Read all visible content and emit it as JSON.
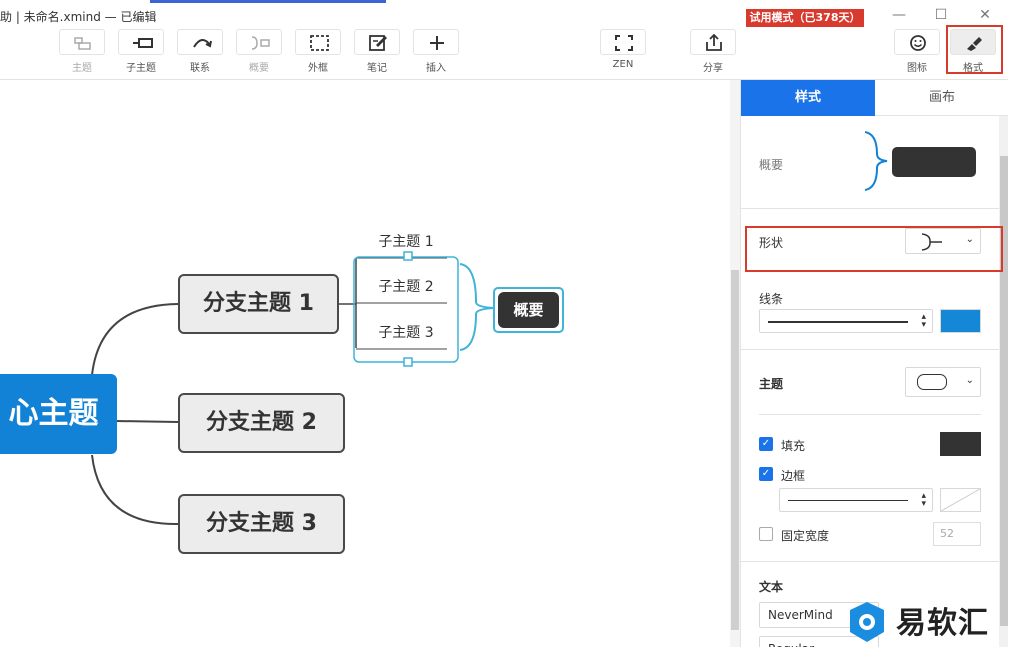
{
  "titlebar": {
    "title": "助  | 未命名.xmind  — 已编辑",
    "trial_badge": "试用模式（已378天）",
    "minimize": "—",
    "maximize": "☐",
    "close": "✕"
  },
  "toolbar": {
    "items": [
      {
        "label": "主题",
        "icon": "topic-icon",
        "disabled": true
      },
      {
        "label": "子主题",
        "icon": "subtopic-icon",
        "disabled": false
      },
      {
        "label": "联系",
        "icon": "relationship-icon",
        "disabled": false
      },
      {
        "label": "概要",
        "icon": "summary-icon",
        "disabled": true
      },
      {
        "label": "外框",
        "icon": "boundary-icon",
        "disabled": false
      },
      {
        "label": "笔记",
        "icon": "note-icon",
        "disabled": false
      },
      {
        "label": "插入",
        "icon": "plus-icon",
        "disabled": false
      },
      {
        "label": "ZEN",
        "icon": "fullscreen-icon",
        "disabled": false
      },
      {
        "label": "分享",
        "icon": "share-icon",
        "disabled": false
      },
      {
        "label": "图标",
        "icon": "smiley-icon",
        "disabled": false
      },
      {
        "label": "格式",
        "icon": "format-brush-icon",
        "disabled": false
      }
    ]
  },
  "canvas": {
    "central_topic": "心主题",
    "branches": [
      "分支主题 1",
      "分支主题 2",
      "分支主题 3"
    ],
    "subtopics": [
      "子主题 1",
      "子主题 2",
      "子主题 3"
    ],
    "summary": "概要"
  },
  "panel": {
    "tabs": [
      "样式",
      "画布"
    ],
    "summary_label": "概要",
    "shape_label": "形状",
    "line_label": "线条",
    "topic_label": "主题",
    "fill_label": "填充",
    "border_label": "边框",
    "fixed_width_label": "固定宽度",
    "fixed_width_value": "52",
    "text_label": "文本",
    "font_name": "NeverMind",
    "font_style": "Regular"
  },
  "watermark": {
    "text": "易软汇"
  },
  "colors": {
    "accent": "#1a73e8",
    "central": "#1182d5",
    "highlight_red": "#d93a2e",
    "summary_border": "#3fb3d8",
    "dark_fill": "#333333"
  }
}
